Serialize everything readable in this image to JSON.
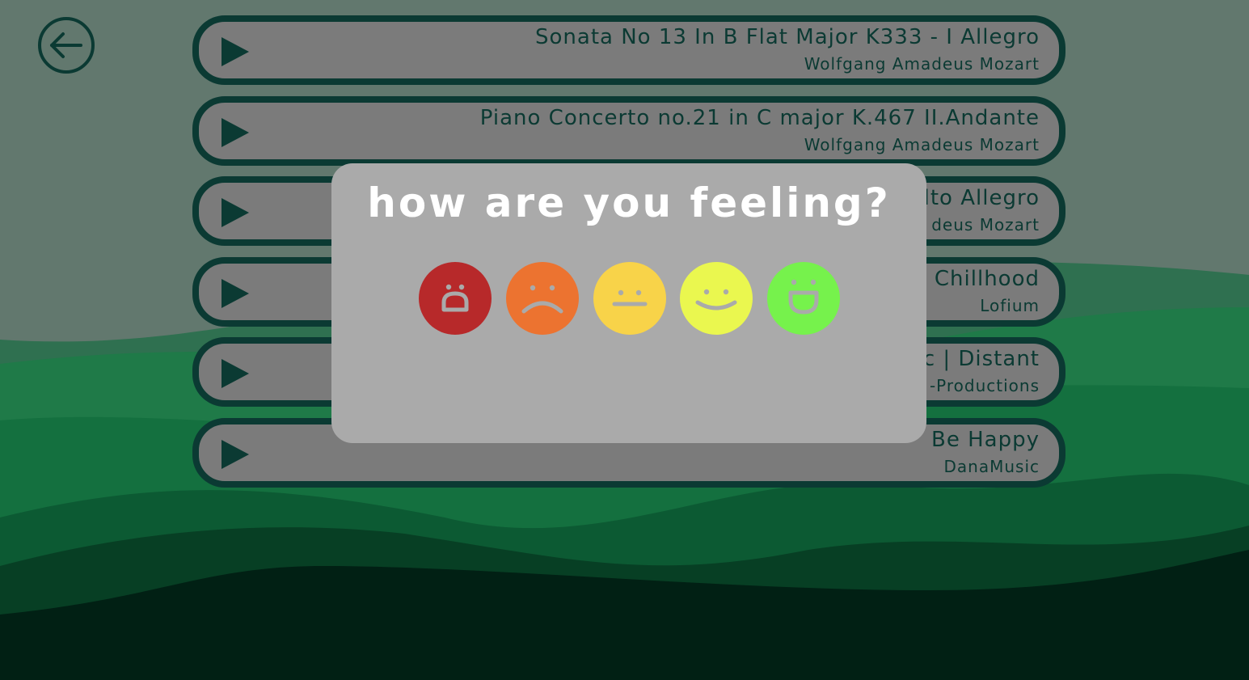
{
  "colors": {
    "track_border": "#0b3a33",
    "track_bg": "#7b7b7b",
    "modal_bg": "#aaaaaa",
    "face_very_sad": "#b7292a",
    "face_sad": "#ec7330",
    "face_neutral": "#f8d349",
    "face_happy": "#eaf74f",
    "face_very_happy": "#76f24c"
  },
  "nav": {
    "back_icon": "back-arrow-icon"
  },
  "tracks": [
    {
      "title": "Sonata No 13 In B Flat Major K333 - I Allegro",
      "artist": "Wolfgang Amadeus Mozart"
    },
    {
      "title": "Piano Concerto no.21 in C major K.467 II.Andante",
      "artist": "Wolfgang Amadeus Mozart"
    },
    {
      "title": "lto Allegro",
      "artist": "deus Mozart"
    },
    {
      "title": "x Chillhood",
      "artist": "Lofium"
    },
    {
      "title": "c | Distant",
      "artist": "-Productions"
    },
    {
      "title": "Be Happy",
      "artist": "DanaMusic"
    }
  ],
  "mood_modal": {
    "title": "how are you feeling?",
    "options": [
      {
        "mood": "very-sad",
        "icon": "very-sad-face-icon"
      },
      {
        "mood": "sad",
        "icon": "sad-face-icon"
      },
      {
        "mood": "neutral",
        "icon": "neutral-face-icon"
      },
      {
        "mood": "happy",
        "icon": "happy-face-icon"
      },
      {
        "mood": "very-happy",
        "icon": "very-happy-face-icon"
      }
    ]
  }
}
